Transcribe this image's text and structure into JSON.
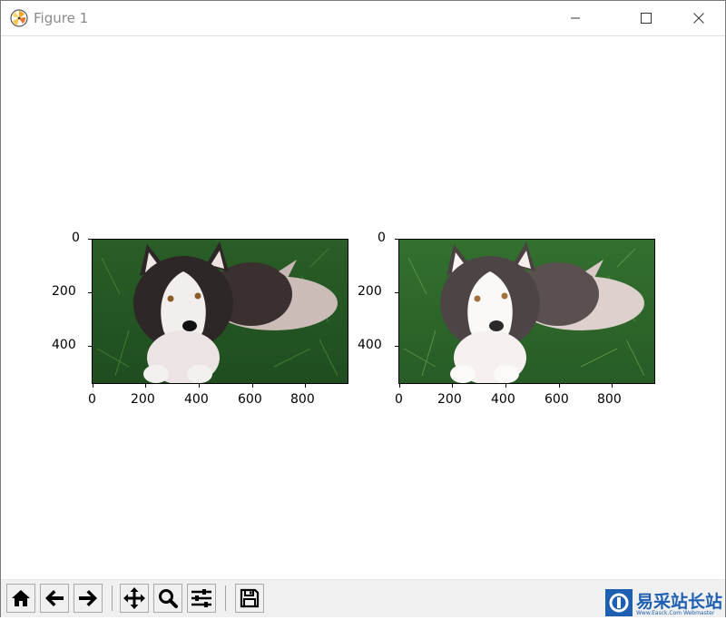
{
  "window": {
    "title": "Figure 1"
  },
  "figure": {
    "subplots": [
      {
        "image_description": "husky-puppy-original",
        "y_ticks": [
          "0",
          "200",
          "400"
        ],
        "x_ticks": [
          "0",
          "200",
          "400",
          "600",
          "800"
        ]
      },
      {
        "image_description": "husky-puppy-brightened",
        "y_ticks": [
          "0",
          "200",
          "400"
        ],
        "x_ticks": [
          "0",
          "200",
          "400",
          "600",
          "800"
        ]
      }
    ]
  },
  "toolbar": {
    "buttons": [
      {
        "name": "home",
        "icon": "home-icon"
      },
      {
        "name": "back",
        "icon": "arrow-left-icon"
      },
      {
        "name": "forward",
        "icon": "arrow-right-icon"
      },
      {
        "name": "pan",
        "icon": "move-icon"
      },
      {
        "name": "zoom",
        "icon": "magnifier-icon"
      },
      {
        "name": "configure-subplots",
        "icon": "sliders-icon"
      },
      {
        "name": "save",
        "icon": "floppy-disk-icon"
      }
    ]
  },
  "watermark": {
    "text": "易采站长站",
    "sub": "Www.Easck.Com  Webmaster"
  },
  "colors": {
    "grass": "#2e6b2a",
    "watermark": "#1f5fb2"
  }
}
